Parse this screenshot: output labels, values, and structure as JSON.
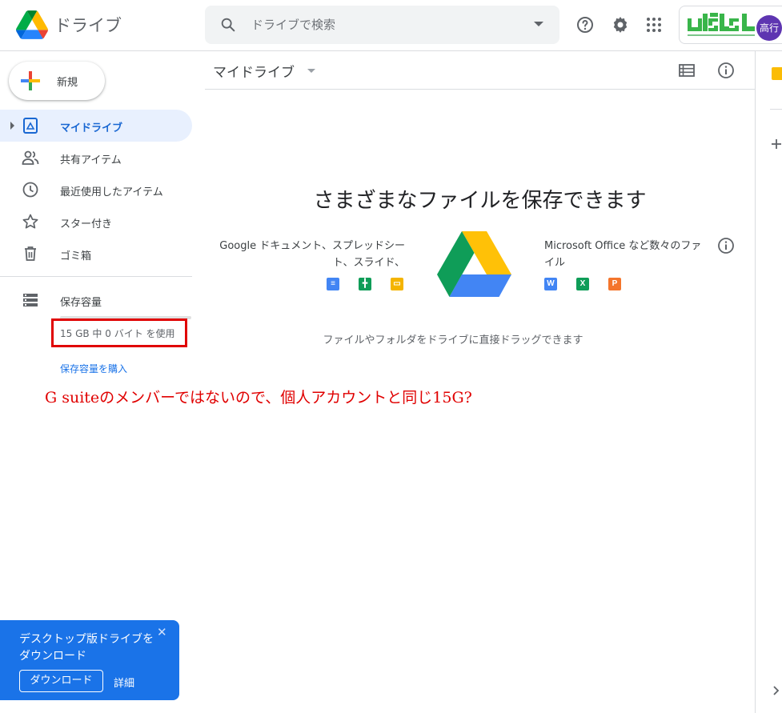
{
  "header": {
    "app_title": "ドライブ",
    "search_placeholder": "ドライブで検索",
    "avatar_text": "高行",
    "org_logo_text": "ULSL"
  },
  "sidebar": {
    "new_label": "新規",
    "items": [
      {
        "label": "マイドライブ",
        "icon": "my-drive-icon",
        "active": true
      },
      {
        "label": "共有アイテム",
        "icon": "shared-icon"
      },
      {
        "label": "最近使用したアイテム",
        "icon": "clock-icon"
      },
      {
        "label": "スター付き",
        "icon": "star-icon"
      },
      {
        "label": "ゴミ箱",
        "icon": "trash-icon"
      }
    ],
    "storage": {
      "label": "保存容量",
      "usage": "15 GB 中 0 バイト を使用",
      "used_fraction": 0,
      "buy": "保存容量を購入"
    }
  },
  "main": {
    "title": "マイドライブ",
    "heading": "さまざまなファイルを保存できます",
    "left_desc": "Google ドキュメント、スプレッドシート、スライド、",
    "right_desc": "Microsoft Office など数々のファイル",
    "right_icons": [
      "W",
      "X",
      "P"
    ],
    "drag_hint": "ファイルやフォルダをドライブに直接ドラッグできます"
  },
  "annotation": "G suiteのメンバーではないので、個人アカウントと同じ15G?",
  "promo": {
    "text": "デスクトップ版ドライブをダウンロード",
    "download": "ダウンロード",
    "details": "詳細",
    "close": "✕"
  },
  "colors": {
    "accent": "#1a73e8",
    "active_bg": "#e8f0fe",
    "annotation_red": "#e00000",
    "avatar": "#5e35b1"
  }
}
